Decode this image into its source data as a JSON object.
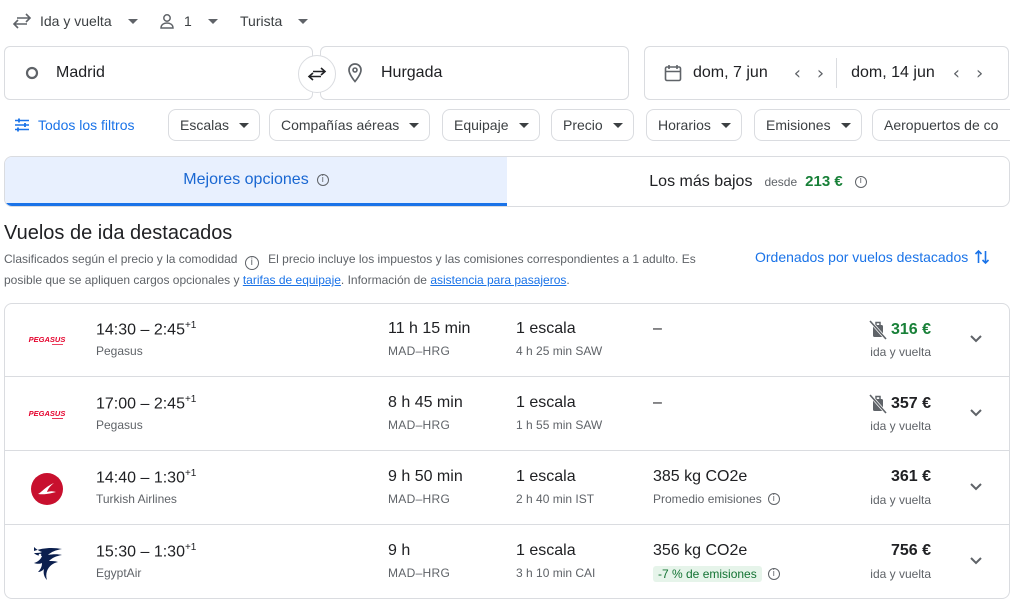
{
  "top": {
    "trip_type": "Ida y vuelta",
    "passengers": "1",
    "cabin": "Turista"
  },
  "search": {
    "origin": "Madrid",
    "destination": "Hurgada",
    "depart_date": "dom, 7 jun",
    "return_date": "dom, 14 jun"
  },
  "filters": {
    "all_filters": "Todos los filtros",
    "chips": [
      "Escalas",
      "Compañías aéreas",
      "Equipaje",
      "Precio",
      "Horarios",
      "Emisiones",
      "Aeropuertos de co"
    ]
  },
  "tabs": {
    "best": "Mejores opciones",
    "cheapest": "Los más bajos",
    "from_label": "desde",
    "cheapest_price": "213 €"
  },
  "section": {
    "title": "Vuelos de ida destacados",
    "desc_part1": "Clasificados según el precio y la comodidad",
    "desc_part2": "El precio incluye los impuestos y las comisiones correspondientes a 1 adulto. Es posible que se apliquen cargos opcionales y",
    "desc_link1": "tarifas de equipaje",
    "desc_part3": ". Información de",
    "desc_link2": "asistencia para pasajeros",
    "desc_part4": ".",
    "sort_label": "Ordenados por vuelos destacados"
  },
  "flights": [
    {
      "times": "14:30 – 2:45",
      "plus_days": "+1",
      "airline": "Pegasus",
      "logo": "pegasus-logo",
      "duration": "11 h 15 min",
      "route": "MAD–HRG",
      "stops": "1 escala",
      "layover": "4 h 25 min SAW",
      "emissions": "–",
      "emissions_note": "",
      "price": "316 €",
      "price_note": "ida y vuelta"
    },
    {
      "times": "17:00 – 2:45",
      "plus_days": "+1",
      "airline": "Pegasus",
      "logo": "pegasus-logo",
      "duration": "8 h 45 min",
      "route": "MAD–HRG",
      "stops": "1 escala",
      "layover": "1 h 55 min SAW",
      "emissions": "–",
      "emissions_note": "",
      "price": "357 €",
      "price_note": "ida y vuelta"
    },
    {
      "times": "14:40 – 1:30",
      "plus_days": "+1",
      "airline": "Turkish Airlines",
      "logo": "turkish-airlines-logo",
      "duration": "9 h 50 min",
      "route": "MAD–HRG",
      "stops": "1 escala",
      "layover": "2 h 40 min IST",
      "emissions": "385 kg CO2e",
      "emissions_note": "Promedio emisiones",
      "price": "361 €",
      "price_note": "ida y vuelta"
    },
    {
      "times": "15:30 – 1:30",
      "plus_days": "+1",
      "airline": "EgyptAir",
      "logo": "egyptair-logo",
      "duration": "9 h",
      "route": "MAD–HRG",
      "stops": "1 escala",
      "layover": "3 h 10 min CAI",
      "emissions": "356 kg CO2e",
      "emissions_note": "-7 % de emisiones",
      "price": "756 €",
      "price_note": "ida y vuelta"
    }
  ],
  "colors": {
    "accent": "#1a73e8",
    "price_green": "#188038",
    "pegasus_red": "#e4002b",
    "turkish_red": "#c8102e",
    "egyptair_navy": "#0b1f4e"
  }
}
